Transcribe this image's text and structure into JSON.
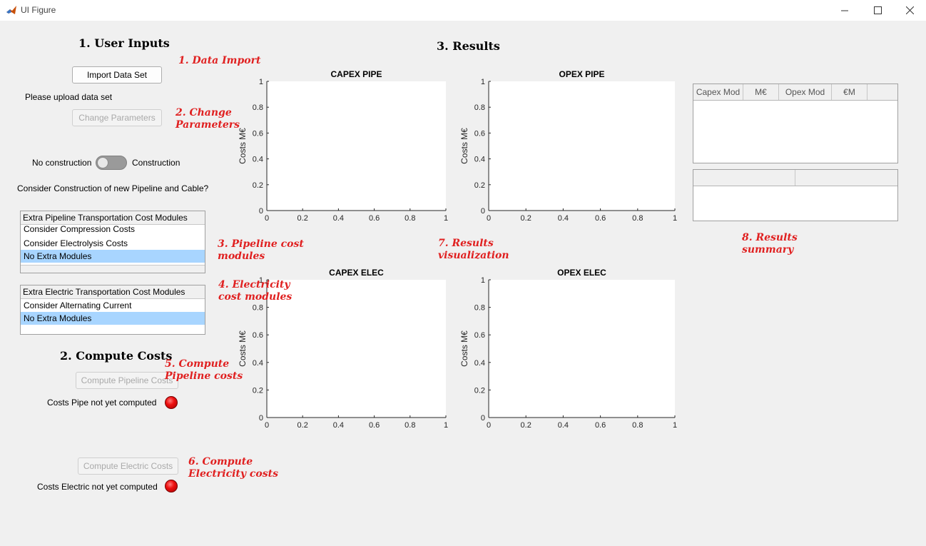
{
  "window": {
    "title": "UI Figure",
    "icon": "matlab-icon",
    "controls": [
      "minimize-icon",
      "maximize-icon",
      "close-icon"
    ]
  },
  "sections": {
    "user_inputs": "1. User Inputs",
    "compute_costs": "2. Compute Costs",
    "results": "3. Results"
  },
  "inputs": {
    "import_button": "Import Data Set",
    "upload_status": "Please upload data set",
    "change_params_button": "Change Parameters",
    "switch_left": "No construction",
    "switch_right": "Construction",
    "switch_state": "No construction",
    "construction_question": "Consider Construction of new Pipeline and Cable?",
    "pipeline_modules": {
      "title": "Extra Pipeline Transportation Cost Modules",
      "items": [
        "Consider Compression Costs",
        "Consider Electrolysis Costs",
        "No Extra Modules"
      ],
      "selected": "No Extra Modules"
    },
    "electric_modules": {
      "title": "Extra Electric Transportation Cost Modules",
      "items": [
        "Consider Alternating Current",
        "No Extra Modules"
      ],
      "selected": "No Extra Modules"
    }
  },
  "compute": {
    "pipe_button": "Compute Pipeline Costs",
    "pipe_status": "Costs Pipe not yet computed",
    "elec_button": "Compute Electric Costs",
    "elec_status": "Costs Electric not yet computed",
    "lamp_color": "#ee1010"
  },
  "annotations": {
    "a1": "1. Data Import",
    "a2": "2. Change\nParameters",
    "a3": "3. Pipeline cost\nmodules",
    "a4": "4. Electricity\ncost modules",
    "a5": "5. Compute\nPipeline costs",
    "a6": "6. Compute\nElectricity costs",
    "a7": "7. Results\nvisualization",
    "a8": "8. Results\nsummary",
    "color": "#e02020"
  },
  "tables": {
    "summary_headers": [
      "Capex Mod",
      "M€",
      "Opex Mod",
      "€M",
      ""
    ],
    "second_headers": [
      "",
      ""
    ]
  },
  "chart_data": [
    {
      "type": "line",
      "title": "CAPEX PIPE",
      "xlabel": "",
      "ylabel": "Costs M€",
      "xlim": [
        0,
        1
      ],
      "ylim": [
        0,
        1
      ],
      "xticks": [
        "0",
        "0.2",
        "0.4",
        "0.6",
        "0.8",
        "1"
      ],
      "yticks": [
        "0",
        "0.2",
        "0.4",
        "0.6",
        "0.8",
        "1"
      ],
      "series": []
    },
    {
      "type": "line",
      "title": "OPEX PIPE",
      "xlabel": "",
      "ylabel": "Costs M€",
      "xlim": [
        0,
        1
      ],
      "ylim": [
        0,
        1
      ],
      "xticks": [
        "0",
        "0.2",
        "0.4",
        "0.6",
        "0.8",
        "1"
      ],
      "yticks": [
        "0",
        "0.2",
        "0.4",
        "0.6",
        "0.8",
        "1"
      ],
      "series": []
    },
    {
      "type": "line",
      "title": "CAPEX ELEC",
      "xlabel": "",
      "ylabel": "Costs M€",
      "xlim": [
        0,
        1
      ],
      "ylim": [
        0,
        1
      ],
      "xticks": [
        "0",
        "0.2",
        "0.4",
        "0.6",
        "0.8",
        "1"
      ],
      "yticks": [
        "0",
        "0.2",
        "0.4",
        "0.6",
        "0.8",
        "1"
      ],
      "series": []
    },
    {
      "type": "line",
      "title": "OPEX ELEC",
      "xlabel": "",
      "ylabel": "Costs M€",
      "xlim": [
        0,
        1
      ],
      "ylim": [
        0,
        1
      ],
      "xticks": [
        "0",
        "0.2",
        "0.4",
        "0.6",
        "0.8",
        "1"
      ],
      "yticks": [
        "0",
        "0.2",
        "0.4",
        "0.6",
        "0.8",
        "1"
      ],
      "series": []
    }
  ]
}
